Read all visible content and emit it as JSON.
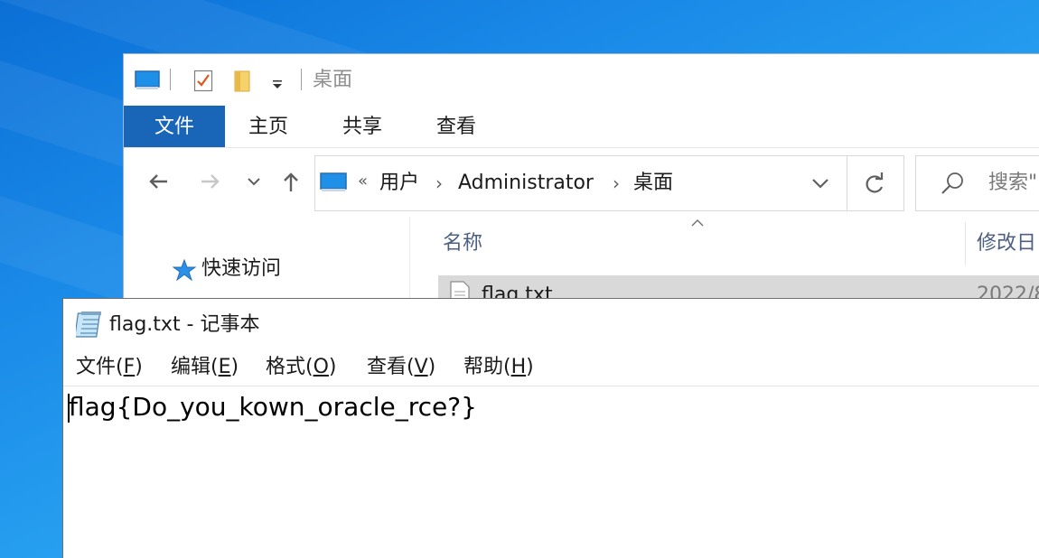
{
  "explorer": {
    "title": "桌面",
    "ribbon_tabs": [
      "文件",
      "主页",
      "共享",
      "查看"
    ],
    "address": {
      "overflow": "«",
      "parts": [
        "用户",
        "Administrator",
        "桌面"
      ]
    },
    "search_placeholder": "搜索\"",
    "nav_pane": {
      "quick_access": "快速访问"
    },
    "columns": {
      "name": "名称",
      "date": "修改日"
    },
    "files": [
      {
        "name": "flag.txt",
        "date": "2022/8"
      }
    ]
  },
  "notepad": {
    "title": "flag.txt - 记事本",
    "menu": [
      {
        "label": "文件(",
        "key": "F",
        "end": ")"
      },
      {
        "label": "编辑(",
        "key": "E",
        "end": ")"
      },
      {
        "label": "格式(",
        "key": "O",
        "end": ")"
      },
      {
        "label": "查看(",
        "key": "V",
        "end": ")"
      },
      {
        "label": "帮助(",
        "key": "H",
        "end": ")"
      }
    ],
    "content": "flag{Do_you_kown_oracle_rce?}"
  },
  "colors": {
    "desktop": "#1a86e4",
    "file_tab": "#1965b8",
    "selected_row": "#d9d9d9",
    "column_header": "#4d6082"
  }
}
